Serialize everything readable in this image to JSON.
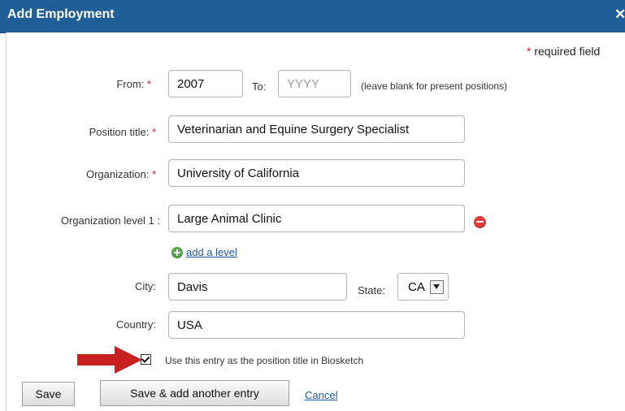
{
  "dialog": {
    "title": "Add Employment",
    "close_icon": "close-icon",
    "required_note": "required field"
  },
  "form": {
    "from_label": "From:",
    "from_value": "2007",
    "to_label": "To:",
    "to_placeholder": "YYYY",
    "to_hint": "(leave blank for present positions)",
    "position_title_label": "Position title:",
    "position_title_value": "Veterinarian and Equine Surgery Specialist",
    "organization_label": "Organization:",
    "organization_value": "University of California",
    "org_level1_label": "Organization level 1 :",
    "org_level1_value": "Large Animal Clinic",
    "add_level_link": "add a level",
    "city_label": "City:",
    "city_value": "Davis",
    "state_label": "State:",
    "state_value": "CA",
    "country_label": "Country:",
    "country_value": "USA",
    "use_entry_text": "Use this entry as the position title in Biosketch"
  },
  "buttons": {
    "save": "Save",
    "save_add": "Save & add another entry",
    "cancel": "Cancel"
  },
  "colors": {
    "titlebar": "#1f5e97",
    "required_star": "#d81f1f",
    "link": "#1f57a8",
    "arrow": "#c81f1f"
  }
}
